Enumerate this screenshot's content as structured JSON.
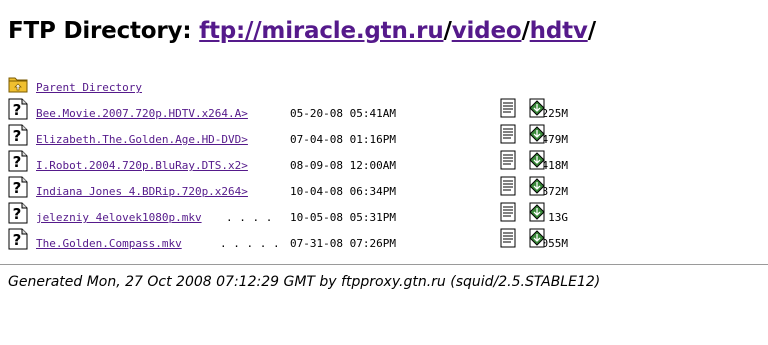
{
  "header": {
    "prefix": "FTP Directory:",
    "path_parts": [
      "ftp://miracle.gtn.ru",
      "video",
      "hdtv"
    ],
    "separator": "/"
  },
  "parent": {
    "label": "Parent Directory",
    "icon": "folder-up-icon"
  },
  "files": [
    {
      "name": "Bee.Movie.2007.720p.HDTV.x264.A>",
      "dots": "",
      "date": "05-20-08 05:41AM",
      "size": "3225M"
    },
    {
      "name": "Elizabeth.The.Golden.Age.HD-DVD>",
      "dots": "",
      "date": "07-04-08 01:16PM",
      "size": "4479M"
    },
    {
      "name": "I.Robot.2004.720p.BluRay.DTS.x2>",
      "dots": "",
      "date": "08-09-08 12:00AM",
      "size": "7418M"
    },
    {
      "name": "Indiana Jones 4.BDRip.720p.x264>",
      "dots": "",
      "date": "10-04-08 06:34PM",
      "size": "4872M"
    },
    {
      "name": "jelezniy 4elovek1080p.mkv",
      "dots": ". . . .",
      "date": "10-05-08 05:31PM",
      "size": "13G"
    },
    {
      "name": "The.Golden.Compass.mkv",
      "dots": ". . . . .",
      "date": "07-31-08 07:26PM",
      "size": "7055M"
    }
  ],
  "footer": {
    "text": "Generated Mon, 27 Oct 2008 07:12:29 GMT by ftpproxy.gtn.ru (squid/2.5.STABLE12)"
  },
  "colors": {
    "link": "#551a8b",
    "folder": "#f0c030",
    "hr": "#9a9a9a"
  }
}
